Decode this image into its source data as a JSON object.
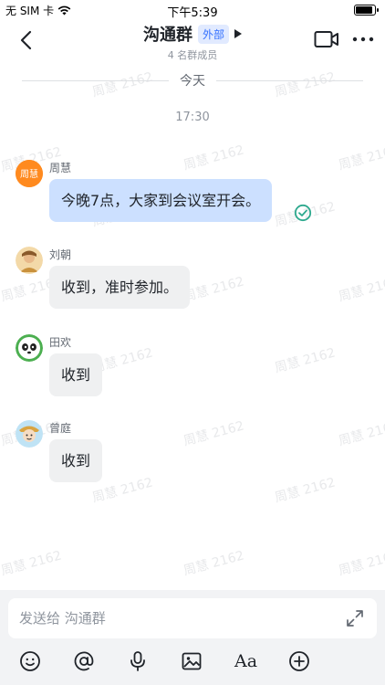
{
  "status_bar": {
    "carrier": "无 SIM 卡",
    "time": "下午5:39",
    "battery_level": 0.8
  },
  "header": {
    "title": "沟通群",
    "badge": "外部",
    "subtitle": "4 名群成员"
  },
  "watermark_text": "周慧 2162",
  "chat": {
    "day_label": "今天",
    "time_stamp": "17:30",
    "messages": [
      {
        "sender": "周慧",
        "text": "今晚7点，大家到会议室开会。",
        "mine": true,
        "avatar_text": "周慧"
      },
      {
        "sender": "刘朝",
        "text": "收到，准时参加。",
        "mine": false
      },
      {
        "sender": "田欢",
        "text": "收到",
        "mine": false
      },
      {
        "sender": "曾庭",
        "text": "收到",
        "mine": false
      }
    ]
  },
  "composer": {
    "placeholder": "发送给 沟通群",
    "tools": [
      "emoji-icon",
      "mention-icon",
      "microphone-icon",
      "image-icon",
      "text-format-icon",
      "add-icon"
    ],
    "format_label": "Aa"
  },
  "colors": {
    "accent": "#3370ff",
    "my_bubble": "#cce0ff",
    "other_bubble": "#eff0f1",
    "read_check": "#2ea98e"
  }
}
